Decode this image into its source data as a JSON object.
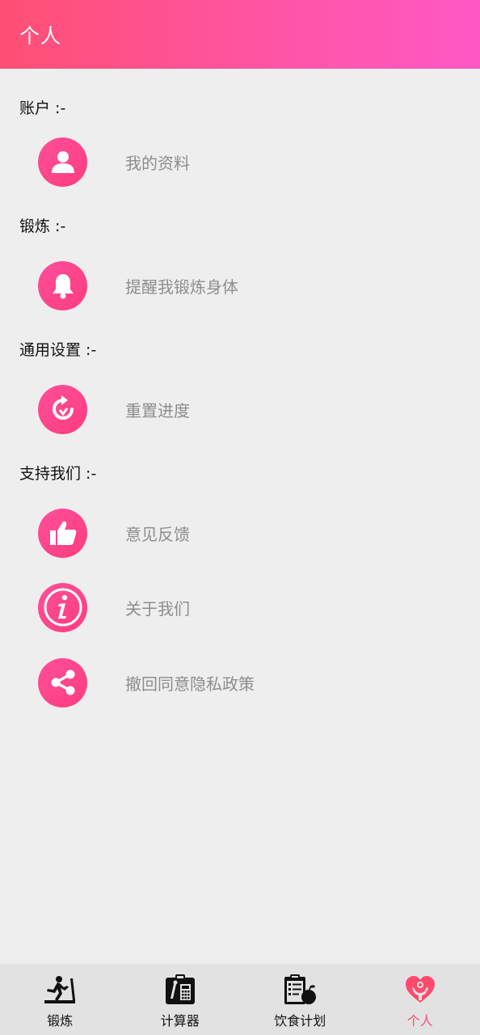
{
  "header": {
    "title": "个人"
  },
  "sections": [
    {
      "title": "账户  :-",
      "items": [
        {
          "label": "我的资料",
          "icon": "person-icon"
        }
      ]
    },
    {
      "title": "锻炼  :-",
      "items": [
        {
          "label": "提醒我锻炼身体",
          "icon": "bell-icon"
        }
      ]
    },
    {
      "title": "通用设置  :-",
      "items": [
        {
          "label": "重置进度",
          "icon": "reset-icon"
        }
      ]
    },
    {
      "title": "支持我们  :-",
      "items": [
        {
          "label": "意见反馈",
          "icon": "thumbs-up-icon"
        },
        {
          "label": "关于我们",
          "icon": "info-icon"
        },
        {
          "label": "撤回同意隐私政策",
          "icon": "share-icon"
        }
      ]
    }
  ],
  "bottom_nav": {
    "items": [
      {
        "label": "锻炼",
        "icon": "treadmill-icon"
      },
      {
        "label": "计算器",
        "icon": "calculator-icon"
      },
      {
        "label": "饮食计划",
        "icon": "diet-plan-icon"
      },
      {
        "label": "个人",
        "icon": "heart-person-icon",
        "active": true
      }
    ]
  },
  "colors": {
    "accent": "#ff4f9a",
    "header_start": "#ff4f74",
    "header_end": "#ff58c4",
    "active_nav": "#ff4a6d"
  }
}
